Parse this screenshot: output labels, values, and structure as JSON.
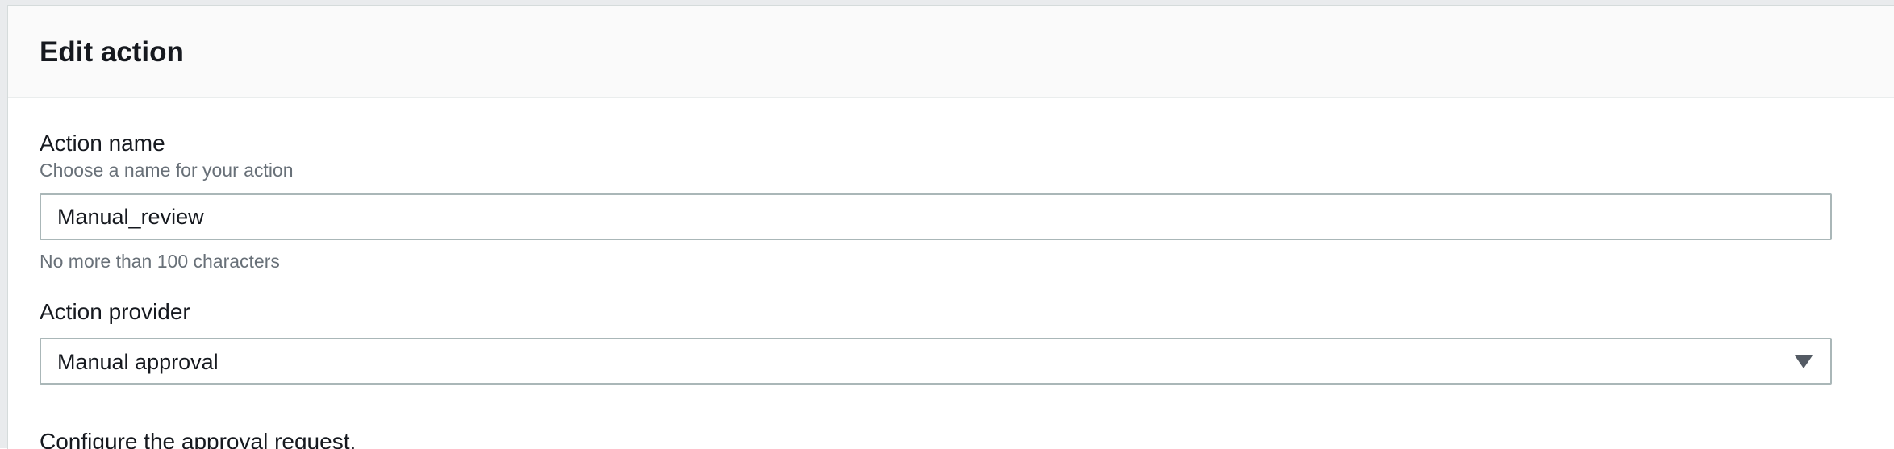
{
  "modal": {
    "title": "Edit action"
  },
  "action_name": {
    "label": "Action name",
    "description": "Choose a name for your action",
    "value": "Manual_review",
    "constraint": "No more than 100 characters"
  },
  "action_provider": {
    "label": "Action provider",
    "selected": "Manual approval"
  },
  "approval": {
    "heading": "Configure the approval request."
  },
  "colors": {
    "header_bg": "#fafafa",
    "input_border": "#aab7b8",
    "secondary_text": "#687078",
    "caret": "#545b64"
  },
  "icons": {
    "select_caret": "caret-down-icon"
  }
}
